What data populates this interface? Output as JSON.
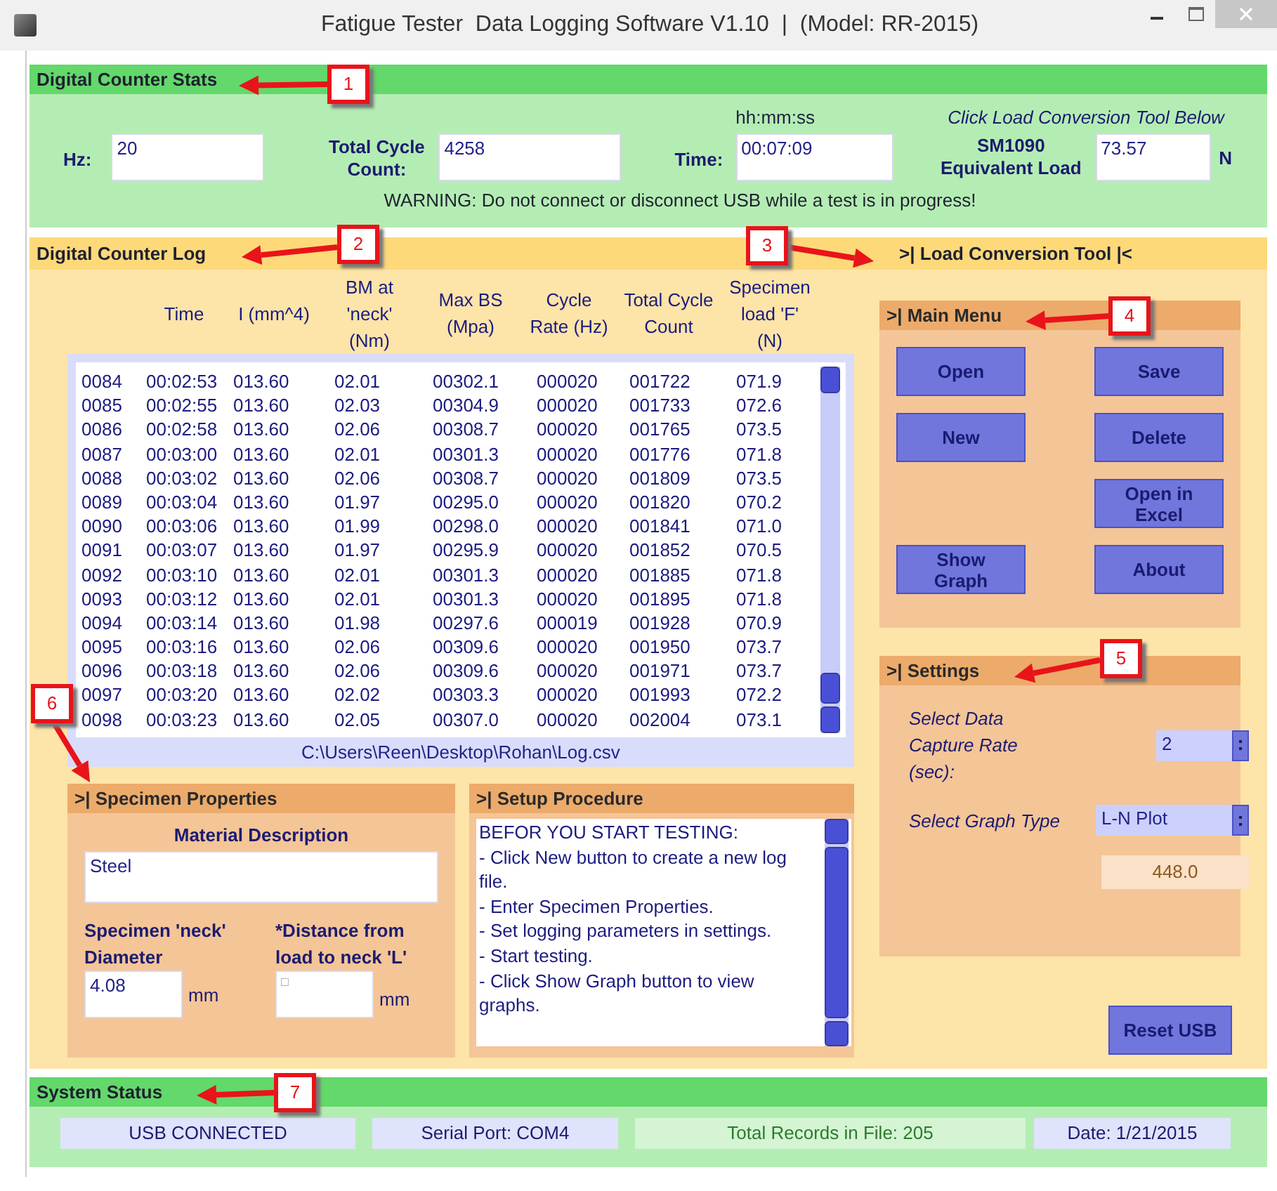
{
  "window": {
    "title": "Fatigue Tester  Data Logging Software V1.10  |  (Model: RR-2015)"
  },
  "counter_stats": {
    "title": "Digital Counter Stats",
    "hz_label": "Hz:",
    "hz": "20",
    "cycle_label": "Total Cycle Count:",
    "cycle": "4258",
    "time_hint": "hh:mm:ss",
    "time_label": "Time:",
    "time": "00:07:09",
    "tool_hint": "Click Load Conversion Tool Below",
    "load_label": "SM1090 Equivalent Load",
    "load": "73.57",
    "load_unit": "N",
    "warning": "WARNING: Do not connect or disconnect USB while a test is in progress!"
  },
  "counter_log": {
    "title": "Digital Counter Log",
    "tool_link": ">| Load Conversion Tool |<",
    "columns": [
      "",
      "Time",
      "I (mm^4)",
      "BM at 'neck' (Nm)",
      "Max BS (Mpa)",
      "Cycle Rate (Hz)",
      "Total Cycle Count",
      "Specimen load 'F' (N)"
    ],
    "rows": [
      [
        "0084",
        "00:02:53",
        "013.60",
        "02.01",
        "00302.1",
        "000020",
        "001722",
        "071.9"
      ],
      [
        "0085",
        "00:02:55",
        "013.60",
        "02.03",
        "00304.9",
        "000020",
        "001733",
        "072.6"
      ],
      [
        "0086",
        "00:02:58",
        "013.60",
        "02.06",
        "00308.7",
        "000020",
        "001765",
        "073.5"
      ],
      [
        "0087",
        "00:03:00",
        "013.60",
        "02.01",
        "00301.3",
        "000020",
        "001776",
        "071.8"
      ],
      [
        "0088",
        "00:03:02",
        "013.60",
        "02.06",
        "00308.7",
        "000020",
        "001809",
        "073.5"
      ],
      [
        "0089",
        "00:03:04",
        "013.60",
        "01.97",
        "00295.0",
        "000020",
        "001820",
        "070.2"
      ],
      [
        "0090",
        "00:03:06",
        "013.60",
        "01.99",
        "00298.0",
        "000020",
        "001841",
        "071.0"
      ],
      [
        "0091",
        "00:03:07",
        "013.60",
        "01.97",
        "00295.9",
        "000020",
        "001852",
        "070.5"
      ],
      [
        "0092",
        "00:03:10",
        "013.60",
        "02.01",
        "00301.3",
        "000020",
        "001885",
        "071.8"
      ],
      [
        "0093",
        "00:03:12",
        "013.60",
        "02.01",
        "00301.3",
        "000020",
        "001895",
        "071.8"
      ],
      [
        "0094",
        "00:03:14",
        "013.60",
        "01.98",
        "00297.6",
        "000019",
        "001928",
        "070.9"
      ],
      [
        "0095",
        "00:03:16",
        "013.60",
        "02.06",
        "00309.6",
        "000020",
        "001950",
        "073.7"
      ],
      [
        "0096",
        "00:03:18",
        "013.60",
        "02.06",
        "00309.6",
        "000020",
        "001971",
        "073.7"
      ],
      [
        "0097",
        "00:03:20",
        "013.60",
        "02.02",
        "00303.3",
        "000020",
        "001993",
        "072.2"
      ],
      [
        "0098",
        "00:03:23",
        "013.60",
        "02.05",
        "00307.0",
        "000020",
        "002004",
        "073.1"
      ]
    ],
    "file_path": "C:\\Users\\Reen\\Desktop\\Rohan\\Log.csv"
  },
  "specimen": {
    "title": ">| Specimen Properties",
    "material_label": "Material Description",
    "material": "Steel",
    "diameter_label": "Specimen 'neck' Diameter",
    "diameter": "4.08",
    "diameter_unit": "mm",
    "distance_label": "*Distance from load to neck 'L'",
    "distance": "□",
    "distance_unit": "mm"
  },
  "setup": {
    "title": ">| Setup Procedure",
    "lines": [
      "BEFOR YOU START TESTING:",
      " - Click New button to create a new log file.",
      " - Enter Specimen Properties.",
      " - Set logging parameters in settings.",
      " - Start testing.",
      " - Click Show Graph button to view graphs."
    ]
  },
  "main_menu": {
    "title": ">| Main Menu",
    "rows": [
      {
        "left": "Open",
        "right": "Save"
      },
      {
        "left": "New",
        "right": "Delete"
      },
      {
        "right": "Open in Excel"
      },
      {
        "left": "Show Graph",
        "right": "About"
      }
    ]
  },
  "settings": {
    "title": ">| Settings",
    "rate_label": "Select Data Capture Rate (sec):",
    "rate": "2",
    "graph_label": "Select Graph Type",
    "graph": "L-N Plot",
    "reading": "448.0"
  },
  "reset_button": "Reset USB",
  "system_status": {
    "title": "System Status",
    "items": [
      {
        "text": "USB CONNECTED",
        "kind": "info"
      },
      {
        "text": "Serial Port: COM4",
        "kind": "info"
      },
      {
        "text": "Total Records in File: 205",
        "kind": "ok"
      },
      {
        "text": "Date: 1/21/2015",
        "kind": "info"
      }
    ]
  },
  "callouts": [
    {
      "label": "1"
    },
    {
      "label": "2"
    },
    {
      "label": "3"
    },
    {
      "label": "4"
    },
    {
      "label": "5"
    },
    {
      "label": "6"
    },
    {
      "label": "7"
    }
  ]
}
